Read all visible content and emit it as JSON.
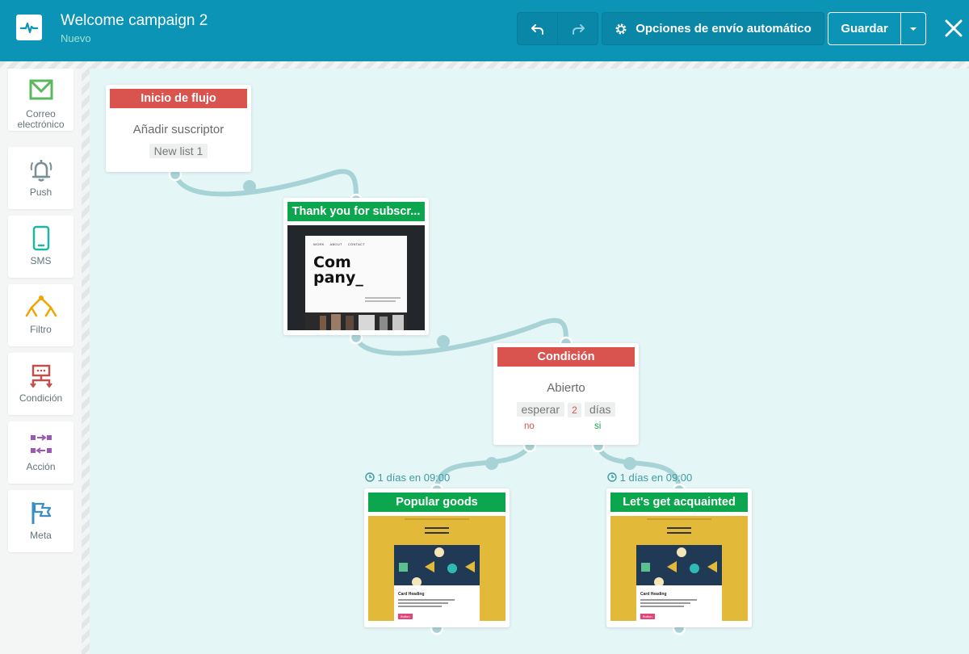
{
  "header": {
    "title": "Welcome campaign 2",
    "status": "Nuevo",
    "auto_send_label": "Opciones de envío automático",
    "save_label": "Guardar"
  },
  "sidebar": {
    "items": [
      {
        "label_1": "Correo",
        "label_2": "electrónico",
        "icon": "envelope-icon",
        "color": "#5cb85c"
      },
      {
        "label_1": "Push",
        "icon": "bell-icon",
        "color": "#7a8f9a"
      },
      {
        "label_1": "SMS",
        "icon": "phone-icon",
        "color": "#1fb5a6"
      },
      {
        "label_1": "Filtro",
        "icon": "filter-icon",
        "color": "#f0a500"
      },
      {
        "label_1": "Condición",
        "icon": "condition-icon",
        "color": "#c0504d"
      },
      {
        "label_1": "Acción",
        "icon": "action-icon",
        "color": "#9b59b6"
      },
      {
        "label_1": "Meta",
        "icon": "flag-icon",
        "color": "#3a8fc7"
      }
    ]
  },
  "flow": {
    "start": {
      "title": "Inicio de flujo",
      "event": "Añadir suscriptor",
      "list": "New list 1"
    },
    "email1": {
      "title": "Thank you for subscr...",
      "thumb_logo_1": "Com",
      "thumb_logo_2": "pany_",
      "thumb_nav_1": "WORK",
      "thumb_nav_2": "ABOUT",
      "thumb_nav_3": "CONTACT"
    },
    "condition": {
      "title": "Condición",
      "event": "Abierto",
      "wait_label": "esperar",
      "wait_value": "2",
      "wait_unit": "días",
      "branch_no": "no",
      "branch_yes": "si"
    },
    "email2": {
      "title": "Popular goods",
      "delay": "1 días en 09:00",
      "card_heading": "Card Heading",
      "button": "Button"
    },
    "email3": {
      "title": "Let's get acquainted",
      "delay": "1 días en 09:00",
      "card_heading": "Card Heading",
      "button": "Button"
    }
  },
  "colors": {
    "header": "#0b94b6",
    "canvas": "#e5f6f7",
    "link": "#a8d3d6",
    "red": "#d9534f",
    "green": "#0ca64e"
  }
}
